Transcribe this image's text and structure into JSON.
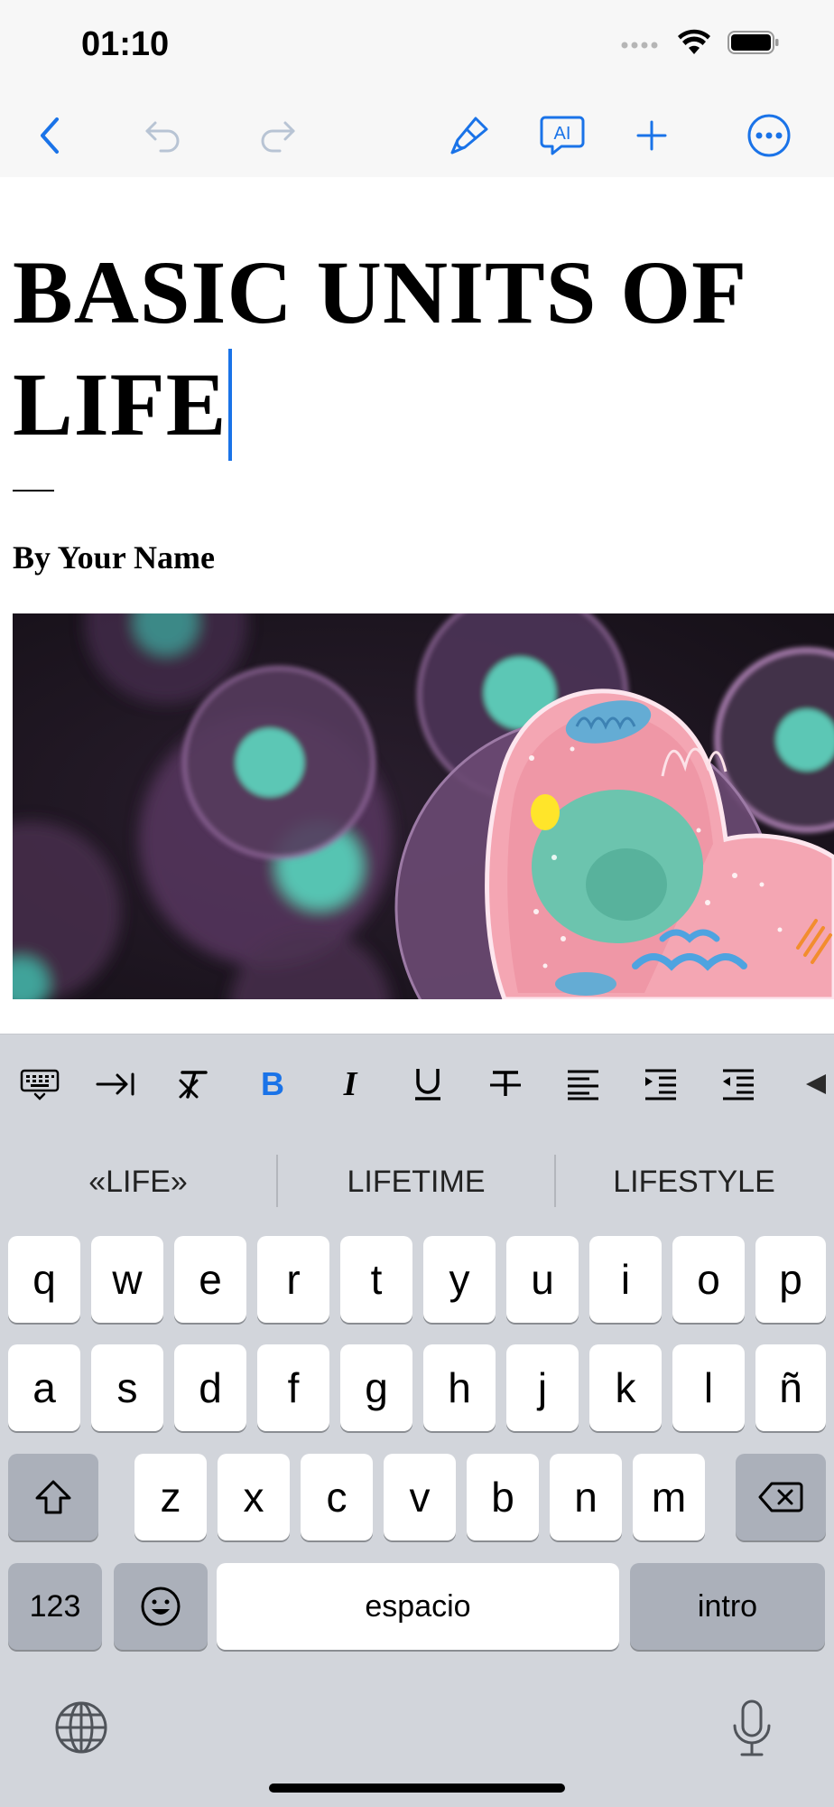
{
  "status": {
    "time": "01:10"
  },
  "toolbar": {
    "icons": [
      "back-chevron-icon",
      "undo-icon",
      "redo-icon",
      "paintbrush-icon",
      "ai-icon",
      "plus-icon",
      "more-icon"
    ],
    "ai_label": "AI"
  },
  "document": {
    "title_line1": "BASIC UNITS OF",
    "title_line2": "LIFE",
    "author": "By Your Name"
  },
  "format_bar": {
    "items": [
      "keyboard-hide-icon",
      "tab-icon",
      "clear-format-icon",
      "bold-icon",
      "italic-icon",
      "underline-icon",
      "strikethrough-icon",
      "align-left-icon",
      "indent-increase-icon",
      "indent-decrease-icon",
      "more-arrow-icon"
    ],
    "bold_label": "B",
    "italic_label": "I",
    "underline_label": "U",
    "accent_color": "#1a73e8"
  },
  "keyboard": {
    "suggestions": [
      "«LIFE»",
      "LIFETIME",
      "LIFESTYLE"
    ],
    "row1": [
      "q",
      "w",
      "e",
      "r",
      "t",
      "y",
      "u",
      "i",
      "o",
      "p"
    ],
    "row2": [
      "a",
      "s",
      "d",
      "f",
      "g",
      "h",
      "j",
      "k",
      "l",
      "ñ"
    ],
    "row3": [
      "z",
      "x",
      "c",
      "v",
      "b",
      "n",
      "m"
    ],
    "numbers_label": "123",
    "space_label": "espacio",
    "return_label": "intro"
  }
}
